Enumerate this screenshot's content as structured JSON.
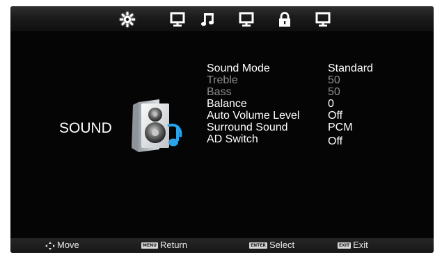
{
  "tabs": [
    {
      "icon": "picture-gear-icon",
      "active": true
    },
    {
      "icon": "monitor-icon",
      "active": false
    },
    {
      "icon": "music-note-icon",
      "active": false
    },
    {
      "icon": "monitor-icon",
      "active": false
    },
    {
      "icon": "lock-icon",
      "active": false
    },
    {
      "icon": "monitor-icon",
      "active": false
    }
  ],
  "section": {
    "label": "SOUND",
    "icon": "speaker-icon"
  },
  "menu": {
    "items": [
      {
        "label": "Sound Mode",
        "value": "Standard",
        "enabled": true
      },
      {
        "label": "Treble",
        "value": "50",
        "enabled": false
      },
      {
        "label": "Bass",
        "value": "50",
        "enabled": false
      },
      {
        "label": "Balance",
        "value": "0",
        "enabled": true
      },
      {
        "label": "Auto Volume Level",
        "value": "Off",
        "enabled": true
      },
      {
        "label": "Surround Sound",
        "value": "PCM",
        "enabled": true
      },
      {
        "label": "AD Switch",
        "value": "Off",
        "enabled": true
      }
    ]
  },
  "footer": {
    "move": {
      "label": "Move",
      "icon": "four-way-arrow-icon"
    },
    "return": {
      "key": "MENU",
      "label": "Return"
    },
    "select": {
      "key": "ENTER",
      "label": "Select"
    },
    "exit": {
      "key": "EXIT",
      "label": "Exit"
    }
  },
  "colors": {
    "background": "#050505",
    "text_enabled": "#ffffff",
    "text_disabled": "#8d8d8d",
    "speaker_accent": "#2aa3e8"
  }
}
